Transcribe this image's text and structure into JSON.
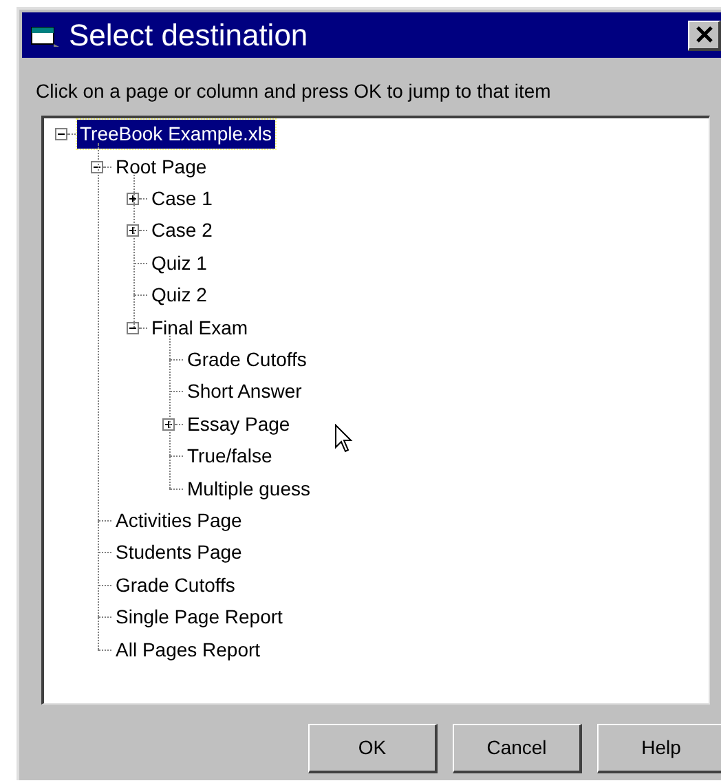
{
  "window": {
    "title": "Select destination"
  },
  "instructions": "Click on a page or column and press OK to jump to that item",
  "tree": [
    {
      "label": "TreeBook Example.xls",
      "kind": "branch",
      "expanded": true,
      "selected": true,
      "children": [
        {
          "label": "Root Page",
          "kind": "branch",
          "expanded": true,
          "selected": false,
          "children": [
            {
              "label": "Case 1",
              "kind": "branch",
              "expanded": false,
              "selected": false
            },
            {
              "label": "Case 2",
              "kind": "branch",
              "expanded": false,
              "selected": false
            },
            {
              "label": "Quiz 1",
              "kind": "leaf",
              "selected": false
            },
            {
              "label": "Quiz 2",
              "kind": "leaf",
              "selected": false
            },
            {
              "label": "Final Exam",
              "kind": "branch",
              "expanded": true,
              "selected": false,
              "children": [
                {
                  "label": "Grade Cutoffs",
                  "kind": "leaf",
                  "selected": false
                },
                {
                  "label": "Short Answer",
                  "kind": "leaf",
                  "selected": false
                },
                {
                  "label": "Essay Page",
                  "kind": "branch",
                  "expanded": false,
                  "selected": false
                },
                {
                  "label": "True/false",
                  "kind": "leaf",
                  "selected": false
                },
                {
                  "label": "Multiple guess",
                  "kind": "leaf",
                  "selected": false
                }
              ]
            }
          ]
        },
        {
          "label": "Activities Page",
          "kind": "leaf",
          "selected": false
        },
        {
          "label": "Students Page",
          "kind": "leaf",
          "selected": false
        },
        {
          "label": "Grade Cutoffs",
          "kind": "leaf",
          "selected": false
        },
        {
          "label": "Single Page Report",
          "kind": "leaf",
          "selected": false
        },
        {
          "label": "All Pages Report",
          "kind": "leaf",
          "selected": false
        }
      ]
    }
  ],
  "buttons": [
    "OK",
    "Cancel",
    "Help"
  ]
}
